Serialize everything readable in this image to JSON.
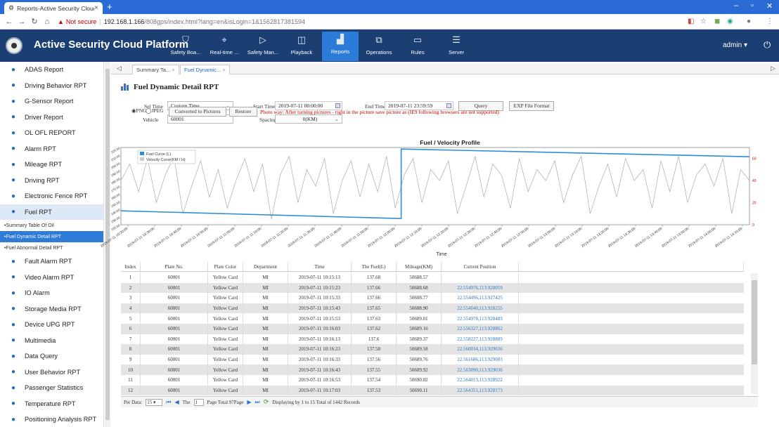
{
  "browser": {
    "tab_title": "Reports-Active Security Cloud",
    "address_not_secure": "Not secure",
    "address_host": "192.168.1.166",
    "address_path": "/808gps/index.html?lang=en&isLogin=1&1562817381594"
  },
  "header": {
    "app_title": "Active Security Cloud Platform",
    "nav": [
      {
        "label": "Safety Boa...",
        "icon": "shield-icon"
      },
      {
        "label": "Real-time ...",
        "icon": "location-pin-icon"
      },
      {
        "label": "Safety Man...",
        "icon": "play-shield-icon"
      },
      {
        "label": "Playback",
        "icon": "playback-icon"
      },
      {
        "label": "Reports",
        "icon": "bar-chart-icon",
        "active": true
      },
      {
        "label": "Operations",
        "icon": "operations-icon"
      },
      {
        "label": "Rules",
        "icon": "rules-icon"
      },
      {
        "label": "Server",
        "icon": "server-icon"
      }
    ],
    "user": "admin"
  },
  "sidebar": {
    "items": [
      {
        "label": "ADAS Report",
        "icon": "shield-check-icon"
      },
      {
        "label": "Driving Behavior RPT",
        "icon": "steering-wheel-icon"
      },
      {
        "label": "G-Sensor Report",
        "icon": "gauge-icon"
      },
      {
        "label": "Driver Report",
        "icon": "warning-icon"
      },
      {
        "label": "OL OFL REPORT",
        "icon": "up-down-arrows-icon"
      },
      {
        "label": "Alarm RPT",
        "icon": "alarm-icon"
      },
      {
        "label": "Mileage RPT",
        "icon": "speedometer-icon"
      },
      {
        "label": "Driving RPT",
        "icon": "parking-icon"
      },
      {
        "label": "Electronic Fence RPT",
        "icon": "fence-pin-icon"
      },
      {
        "label": "Fuel RPT",
        "icon": "fuel-icon",
        "active": true
      }
    ],
    "sub_items": [
      {
        "label": "Summary Table Of Oil"
      },
      {
        "label": "Fuel Dynamic Detail RPT",
        "active": true
      },
      {
        "label": "Fuel Abnormal Detail RPT"
      }
    ],
    "items_after": [
      {
        "label": "Fault Alarm RPT",
        "icon": "fault-shield-icon"
      },
      {
        "label": "Video Alarm RPT",
        "icon": "video-icon"
      },
      {
        "label": "IO Alarm",
        "icon": "io-icon"
      },
      {
        "label": "Storage Media RPT",
        "icon": "storage-icon"
      },
      {
        "label": "Device UPG RPT",
        "icon": "upgrade-icon"
      },
      {
        "label": "Multimedia",
        "icon": "multimedia-icon"
      },
      {
        "label": "Data Query",
        "icon": "query-icon"
      },
      {
        "label": "User Behavior RPT",
        "icon": "user-behavior-icon"
      },
      {
        "label": "Passenger Statistics",
        "icon": "passenger-icon"
      },
      {
        "label": "Temperature RPT",
        "icon": "thermometer-icon"
      },
      {
        "label": "Positioning Analysis RPT",
        "icon": "target-icon"
      }
    ]
  },
  "tabs": [
    {
      "label": "Summary Ta..."
    },
    {
      "label": "Fuel Dynamic...",
      "active": true
    }
  ],
  "page": {
    "title": "Fuel Dynamic Detail RPT",
    "sel_time_label": "Sel Time",
    "sel_time_value": "Custom Time",
    "start_time_label": "Start Time",
    "start_time_value": "2019-07-11 00:00:00",
    "end_time_label": "End Time",
    "end_time_value": "2019-07-11 23:59:59",
    "query_button": "Query",
    "exp_button": "EXP File Format",
    "vehicle_label": "Vehicle",
    "vehicle_value": "60001",
    "spacing_label": "Spacing",
    "spacing_value": "0(KM)",
    "png_label": "PNG",
    "jpeg_label": "JPEG",
    "convert_button": "Converted to Pictures",
    "restore_button": "Restore",
    "photo_note": "Photo way: After turning pictures - right in the picture save picture as (IE9 following browsers are not supported)"
  },
  "chart_data": {
    "type": "line",
    "title": "Fuel / Velocity Profile",
    "xlabel": "Time",
    "legend": [
      "Fuel Curve (L)",
      "Velocity Curve(KM / H)"
    ],
    "legend_position": "top-left",
    "colors": {
      "fuel": "#2a8fd8",
      "velocity": "#aaaaaa"
    },
    "left_ticks": [
      "120.00",
      "130.00",
      "140.00",
      "150.00",
      "160.00",
      "170.00",
      "180.00",
      "190.00",
      "200.00",
      "210.00",
      "220.00"
    ],
    "right_ticks": [
      "0",
      "20",
      "40",
      "60"
    ],
    "x_ticks": [
      "2019-07-11 10:20:00",
      "2019-07-11 10:30:00",
      "2019-07-11 10:40:00",
      "2019-07-11 10:50:00",
      "2019-07-11 11:00:00",
      "2019-07-11 11:10:00",
      "2019-07-11 11:20:00",
      "2019-07-11 11:30:00",
      "2019-07-11 11:40:00",
      "2019-07-11 11:50:00",
      "2019-07-11 12:00:00",
      "2019-07-11 12:10:00",
      "2019-07-11 12:20:00",
      "2019-07-11 12:30:00",
      "2019-07-11 12:40:00",
      "2019-07-11 12:50:00",
      "2019-07-11 13:00:00",
      "2019-07-11 13:10:00",
      "2019-07-11 13:20:00",
      "2019-07-11 13:30:00",
      "2019-07-11 13:40:00",
      "2019-07-11 13:50:00",
      "2019-07-11 14:00:00",
      "2019-07-11 14:10:00"
    ],
    "fuel_series": {
      "name": "Fuel Curve (L)",
      "x": [
        "10:15",
        "12:02",
        "12:02",
        "14:15"
      ],
      "y": [
        138,
        128,
        218,
        208
      ]
    },
    "velocity_series": {
      "name": "Velocity Curve(KM / H)",
      "y_estimate": [
        40,
        55,
        30,
        60,
        20,
        45,
        62,
        10,
        35,
        58,
        25,
        50,
        15,
        40,
        60,
        30,
        55,
        5,
        45,
        62,
        20,
        50,
        35,
        60,
        10,
        40,
        58,
        25,
        55,
        30,
        62,
        15,
        45,
        60,
        20,
        50,
        40,
        58,
        10,
        35,
        62,
        25,
        55,
        45,
        15,
        60,
        30,
        50,
        40,
        58,
        20,
        45,
        62,
        10,
        35,
        55,
        25,
        60,
        40,
        50,
        15,
        58,
        30,
        62,
        20,
        45,
        55,
        35,
        60,
        10,
        50,
        40
      ]
    }
  },
  "table": {
    "columns": [
      "Index",
      "Plate No.",
      "Plate Color",
      "Department",
      "Time",
      "The Fuel(L)",
      "Mileage(KM)",
      "Current Position"
    ],
    "rows": [
      [
        "1",
        "60001",
        "Yellow Card",
        "MI",
        "2019-07-11 10:15:13",
        "137.68",
        "50688.57",
        ""
      ],
      [
        "2",
        "60001",
        "Yellow Card",
        "MI",
        "2019-07-11 10:15:23",
        "137.66",
        "50688.68",
        "22.554976,113.928059"
      ],
      [
        "3",
        "60001",
        "Yellow Card",
        "MI",
        "2019-07-11 10:15:33",
        "137.66",
        "50688.77",
        "22.554496,113.927425"
      ],
      [
        "4",
        "60001",
        "Yellow Card",
        "MI",
        "2019-07-11 10:15:43",
        "137.65",
        "50688.90",
        "22.554040,113.928255"
      ],
      [
        "5",
        "60001",
        "Yellow Card",
        "MI",
        "2019-07-11 10:15:53",
        "137.63",
        "50689.01",
        "22.554978,113.928483"
      ],
      [
        "6",
        "60001",
        "Yellow Card",
        "MI",
        "2019-07-11 10:16:03",
        "137.62",
        "50689.16",
        "22.556327,113.928862"
      ],
      [
        "7",
        "60001",
        "Yellow Card",
        "MI",
        "2019-07-11 10:16:13",
        "137.6",
        "50689.37",
        "22.558227,113.928889"
      ],
      [
        "8",
        "60001",
        "Yellow Card",
        "MI",
        "2019-07-11 10:16:23",
        "137.58",
        "50689.58",
        "22.560034,113.929036"
      ],
      [
        "9",
        "60001",
        "Yellow Card",
        "MI",
        "2019-07-11 10:16:33",
        "137.56",
        "50689.76",
        "22.561686,113.929003"
      ],
      [
        "10",
        "60001",
        "Yellow Card",
        "MI",
        "2019-07-11 10:16:43",
        "137.55",
        "50689.92",
        "22.563090,113.929036"
      ],
      [
        "11",
        "60001",
        "Yellow Card",
        "MI",
        "2019-07-11 10:16:53",
        "137.54",
        "50690.02",
        "22.564013,113.928922"
      ],
      [
        "12",
        "60001",
        "Yellow Card",
        "MI",
        "2019-07-11 10:17:03",
        "137.53",
        "50690.11",
        "22.564351,113.928173"
      ]
    ]
  },
  "pager": {
    "per_data_label": "Per Data:",
    "per_data_value": "15",
    "the_label": "The",
    "page_value": "1",
    "page_total": "Page Total 97Page",
    "display_text": "Displaying by 1 to 15 Total of 1442 Records"
  }
}
